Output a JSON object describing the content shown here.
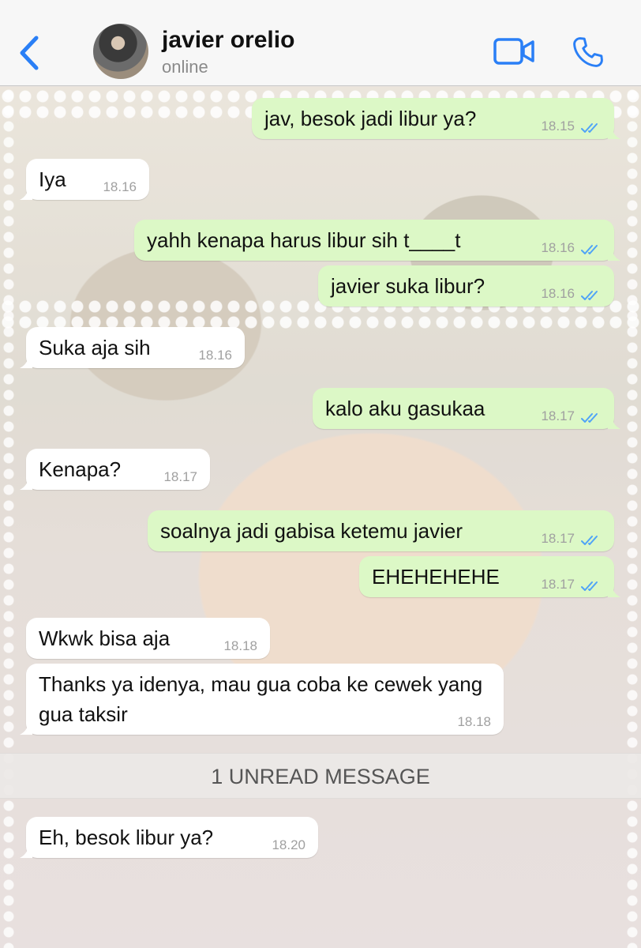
{
  "header": {
    "contact_name": "javier orelio",
    "status": "online"
  },
  "icons": {
    "back": "chevron-left-icon",
    "video": "video-camera-icon",
    "call": "phone-icon",
    "read": "double-check-icon"
  },
  "colors": {
    "accent": "#2a7ff6",
    "outgoing_bubble": "#dcf8c6",
    "incoming_bubble": "#ffffff",
    "read_ticks": "#4fa3f7"
  },
  "messages": [
    {
      "dir": "out",
      "text": "jav, besok jadi libur ya?",
      "time": "18.15"
    },
    {
      "dir": "in",
      "text": "Iya",
      "time": "18.16"
    },
    {
      "dir": "out",
      "text": "yahh kenapa harus libur sih t____t",
      "time": "18.16"
    },
    {
      "dir": "out",
      "text": "javier suka libur?",
      "time": "18.16"
    },
    {
      "dir": "in",
      "text": "Suka aja sih",
      "time": "18.16"
    },
    {
      "dir": "out",
      "text": "kalo aku gasukaa",
      "time": "18.17"
    },
    {
      "dir": "in",
      "text": "Kenapa?",
      "time": "18.17"
    },
    {
      "dir": "out",
      "text": "soalnya jadi gabisa ketemu javier",
      "time": "18.17"
    },
    {
      "dir": "out",
      "text": "EHEHEHEHE",
      "time": "18.17"
    },
    {
      "dir": "in",
      "text": "Wkwk bisa aja",
      "time": "18.18"
    },
    {
      "dir": "in",
      "text": "Thanks ya idenya, mau gua coba ke cewek yang gua taksir",
      "time": "18.18"
    },
    {
      "dir": "in",
      "text": "Eh, besok libur ya?",
      "time": "18.20"
    }
  ],
  "unread_label": "1 UNREAD MESSAGE"
}
